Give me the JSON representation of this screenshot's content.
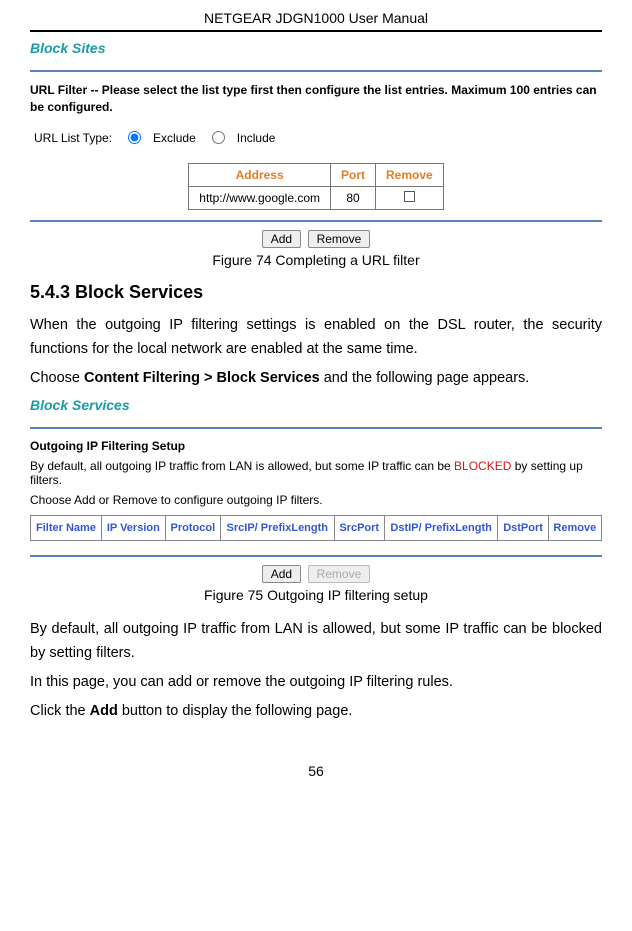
{
  "doc": {
    "header": "NETGEAR JDGN1000 User Manual",
    "page_number": "56"
  },
  "block_sites": {
    "title": "Block Sites",
    "instruction": "URL Filter -- Please select the list type first then configure the list entries. Maximum 100 entries can be configured.",
    "url_list_type_label": "URL List Type:",
    "option_exclude": "Exclude",
    "option_include": "Include",
    "table": {
      "th_address": "Address",
      "th_port": "Port",
      "th_remove": "Remove",
      "row1_address": "http://www.google.com",
      "row1_port": "80"
    },
    "btn_add": "Add",
    "btn_remove": "Remove",
    "figure_caption": "Figure 74 Completing a URL filter"
  },
  "section_543": {
    "heading": "5.4.3   Block Services",
    "para1": "When the outgoing IP filtering settings is enabled on the DSL router, the security functions for the local network are enabled at the same time.",
    "para2_pre": "Choose ",
    "para2_bold": "Content Filtering > Block Services",
    "para2_post": " and the following page appears."
  },
  "block_services": {
    "title": "Block Services",
    "subsection_title": "Outgoing IP Filtering Setup",
    "desc_pre": "By default, all outgoing IP traffic from LAN is allowed, but some IP traffic can be ",
    "desc_blocked": "BLOCKED",
    "desc_post": " by setting up filters.",
    "choose_text": "Choose Add or Remove to configure outgoing IP filters.",
    "table": {
      "th_filter_name": "Filter Name",
      "th_ip_version": "IP Version",
      "th_protocol": "Protocol",
      "th_srcip": "SrcIP/ PrefixLength",
      "th_srcport": "SrcPort",
      "th_dstip": "DstIP/ PrefixLength",
      "th_dstport": "DstPort",
      "th_remove": "Remove"
    },
    "btn_add": "Add",
    "btn_remove": "Remove",
    "figure_caption": "Figure 75 Outgoing IP filtering setup",
    "para_after1": "By default, all outgoing IP traffic from LAN is allowed, but some IP traffic can be blocked by setting filters.",
    "para_after2": "In this page, you can add or remove the outgoing IP filtering rules.",
    "para_after3_pre": "Click the ",
    "para_after3_bold": "Add",
    "para_after3_post": " button to display the following page."
  }
}
